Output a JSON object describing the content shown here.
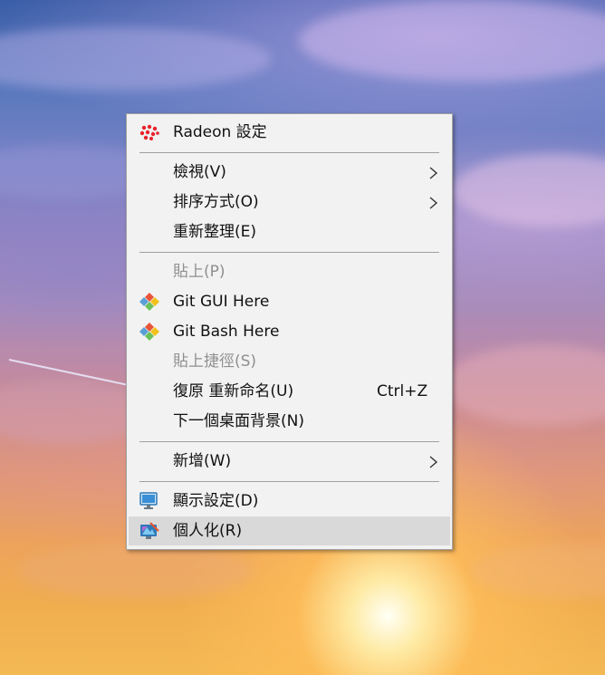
{
  "colors": {
    "menu_bg": "#f2f2f2",
    "hover_bg": "#d9d9d9",
    "disabled_text": "#8f8f8f",
    "separator": "#a0a0a0"
  },
  "context_menu": {
    "items": [
      {
        "label": "Radeon 設定",
        "icon": "radeon-icon",
        "enabled": true
      },
      {
        "label": "檢視(V)",
        "submenu": true,
        "enabled": true
      },
      {
        "label": "排序方式(O)",
        "submenu": true,
        "enabled": true
      },
      {
        "label": "重新整理(E)",
        "enabled": true
      },
      {
        "label": "貼上(P)",
        "enabled": false
      },
      {
        "label": "Git GUI Here",
        "icon": "git-icon",
        "enabled": true
      },
      {
        "label": "Git Bash Here",
        "icon": "git-icon",
        "enabled": true
      },
      {
        "label": "貼上捷徑(S)",
        "enabled": false
      },
      {
        "label": "復原 重新命名(U)",
        "shortcut": "Ctrl+Z",
        "enabled": true
      },
      {
        "label": "下一個桌面背景(N)",
        "enabled": true
      },
      {
        "label": "新增(W)",
        "submenu": true,
        "enabled": true
      },
      {
        "label": "顯示設定(D)",
        "icon": "display-settings-icon",
        "enabled": true
      },
      {
        "label": "個人化(R)",
        "icon": "personalize-icon",
        "enabled": true,
        "highlighted": true
      }
    ]
  }
}
